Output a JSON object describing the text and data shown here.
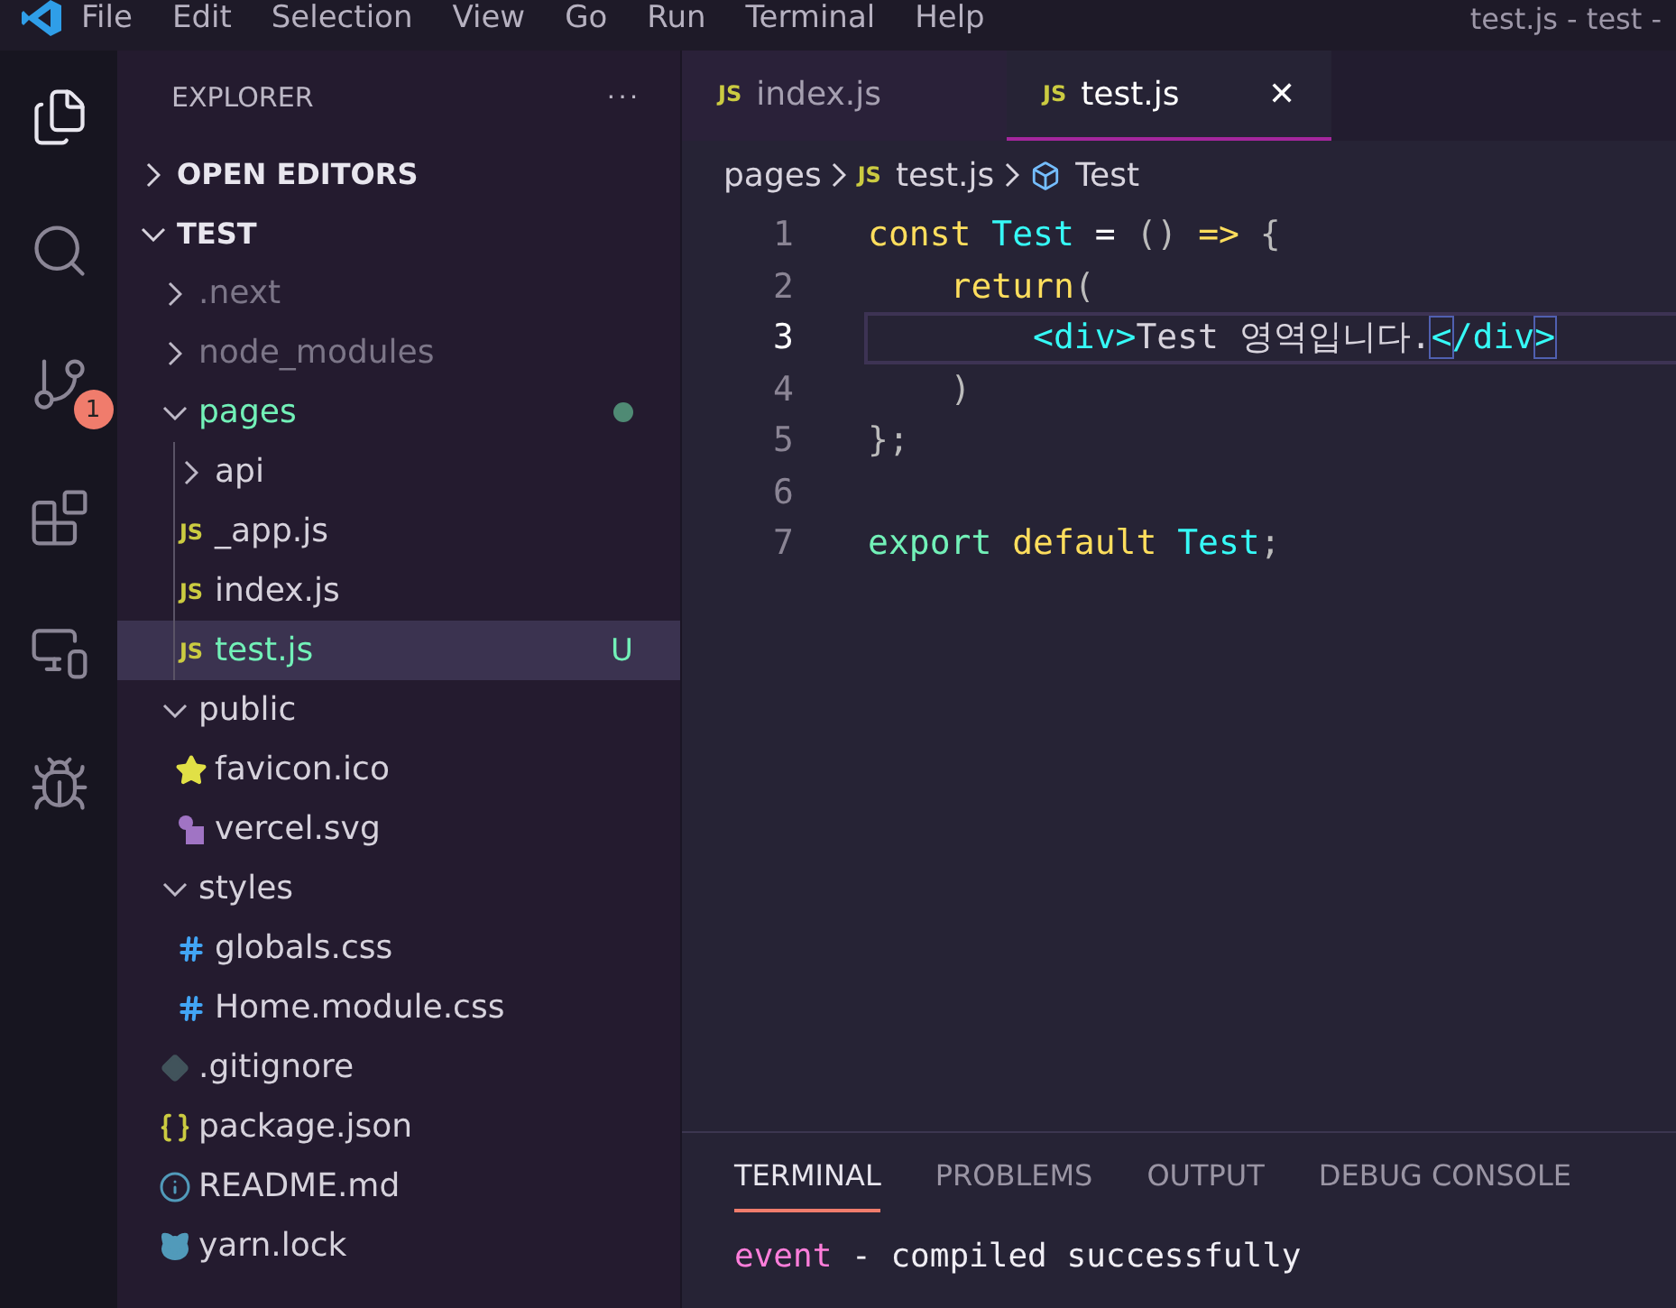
{
  "window": {
    "title": "test.js - test -"
  },
  "menu": [
    "File",
    "Edit",
    "Selection",
    "View",
    "Go",
    "Run",
    "Terminal",
    "Help"
  ],
  "activity_bar": [
    {
      "kind": "explorer",
      "selected": true
    },
    {
      "kind": "search",
      "selected": false
    },
    {
      "kind": "source-control",
      "selected": false,
      "badge": "1"
    },
    {
      "kind": "extensions",
      "selected": false
    },
    {
      "kind": "remote",
      "selected": false
    },
    {
      "kind": "debug",
      "selected": false
    }
  ],
  "sidebar": {
    "title": "EXPLORER",
    "more": "···",
    "sections": [
      {
        "label": "OPEN EDITORS",
        "expanded": false
      },
      {
        "label": "TEST",
        "expanded": true,
        "children": [
          {
            "kind": "folder",
            "label": ".next",
            "expanded": false,
            "color": "#7c7688",
            "selected": false
          },
          {
            "kind": "folder",
            "label": "node_modules",
            "expanded": false,
            "color": "#7c7688",
            "selected": false
          },
          {
            "kind": "folder",
            "label": "pages",
            "expanded": true,
            "color": "#72f1b8",
            "modified": true,
            "selected": false,
            "children": [
              {
                "kind": "folder",
                "label": "api",
                "expanded": false,
                "color": "#d6d2dc",
                "selected": false
              },
              {
                "kind": "js",
                "icon_text": "JS",
                "label": "_app.js",
                "color": "#d6d2dc",
                "selected": false
              },
              {
                "kind": "js",
                "icon_text": "JS",
                "label": "index.js",
                "color": "#d6d2dc",
                "selected": false
              },
              {
                "kind": "js",
                "icon_text": "JS",
                "label": "test.js",
                "color": "#72f1b8",
                "status": "U",
                "selected": true
              }
            ]
          },
          {
            "kind": "folder",
            "label": "public",
            "expanded": true,
            "color": "#d6d2dc",
            "selected": false,
            "children": [
              {
                "kind": "image",
                "label": "favicon.ico",
                "color": "#d6d2dc",
                "selected": false
              },
              {
                "kind": "vector",
                "label": "vercel.svg",
                "color": "#d6d2dc",
                "selected": false
              }
            ]
          },
          {
            "kind": "folder",
            "label": "styles",
            "expanded": true,
            "color": "#d6d2dc",
            "selected": false,
            "children": [
              {
                "kind": "css",
                "label": "globals.css",
                "color": "#d6d2dc",
                "selected": false
              },
              {
                "kind": "css",
                "label": "Home.module.css",
                "color": "#d6d2dc",
                "selected": false
              }
            ]
          },
          {
            "kind": "git",
            "label": ".gitignore",
            "color": "#d6d2dc",
            "selected": false
          },
          {
            "kind": "json",
            "label": "package.json",
            "color": "#d6d2dc",
            "selected": false
          },
          {
            "kind": "readme",
            "label": "README.md",
            "color": "#d6d2dc",
            "selected": false
          },
          {
            "kind": "yarn",
            "label": "yarn.lock",
            "color": "#d6d2dc",
            "selected": false
          }
        ]
      }
    ]
  },
  "tabs": [
    {
      "label": "index.js",
      "icon_text": "JS",
      "selected": false
    },
    {
      "label": "test.js",
      "icon_text": "JS",
      "selected": true,
      "close": "✕"
    }
  ],
  "breadcrumb": [
    {
      "kind": "folder",
      "label": "pages"
    },
    {
      "kind": "file",
      "icon_text": "JS",
      "label": "test.js"
    },
    {
      "kind": "symbol",
      "label": "Test"
    }
  ],
  "code": [
    {
      "number": "1",
      "current": false,
      "tokens": [
        {
          "text": "const",
          "kind": "keyword"
        },
        {
          "text": " Test",
          "kind": "name"
        },
        {
          "text": " =",
          "kind": "op"
        },
        {
          "text": " ()",
          "kind": "punct"
        },
        {
          "text": " =>",
          "kind": "keyword"
        },
        {
          "text": " {",
          "kind": "punct"
        }
      ]
    },
    {
      "number": "2",
      "current": false,
      "tokens": [
        {
          "text": "    return",
          "kind": "keyword"
        },
        {
          "text": "(",
          "kind": "punct"
        }
      ]
    },
    {
      "number": "3",
      "current": true,
      "tokens": [
        {
          "text": "        <div>",
          "kind": "tag"
        },
        {
          "text": "Test 영역입니다.",
          "kind": "text"
        },
        {
          "text": "<",
          "kind": "tag-match"
        },
        {
          "text": "/div",
          "kind": "tag"
        },
        {
          "text": ">",
          "kind": "tag-match"
        }
      ]
    },
    {
      "number": "4",
      "current": false,
      "tokens": [
        {
          "text": "    )",
          "kind": "punct"
        }
      ]
    },
    {
      "number": "5",
      "current": false,
      "tokens": [
        {
          "text": "};",
          "kind": "punct"
        }
      ]
    },
    {
      "number": "6",
      "current": false
    },
    {
      "number": "7",
      "current": false,
      "tokens": [
        {
          "text": "export",
          "kind": "export"
        },
        {
          "text": " default",
          "kind": "keyword"
        },
        {
          "text": " Test",
          "kind": "name"
        },
        {
          "text": ";",
          "kind": "punct"
        }
      ]
    }
  ],
  "panel": {
    "tabs": [
      {
        "label": "TERMINAL",
        "selected": true
      },
      {
        "label": "PROBLEMS",
        "selected": false
      },
      {
        "label": "OUTPUT",
        "selected": false
      },
      {
        "label": "DEBUG CONSOLE",
        "selected": false
      }
    ],
    "lines": [
      [
        {
          "text": "event",
          "kind": "event"
        },
        {
          "text": " - compiled successfully",
          "kind": "plain"
        }
      ]
    ]
  }
}
